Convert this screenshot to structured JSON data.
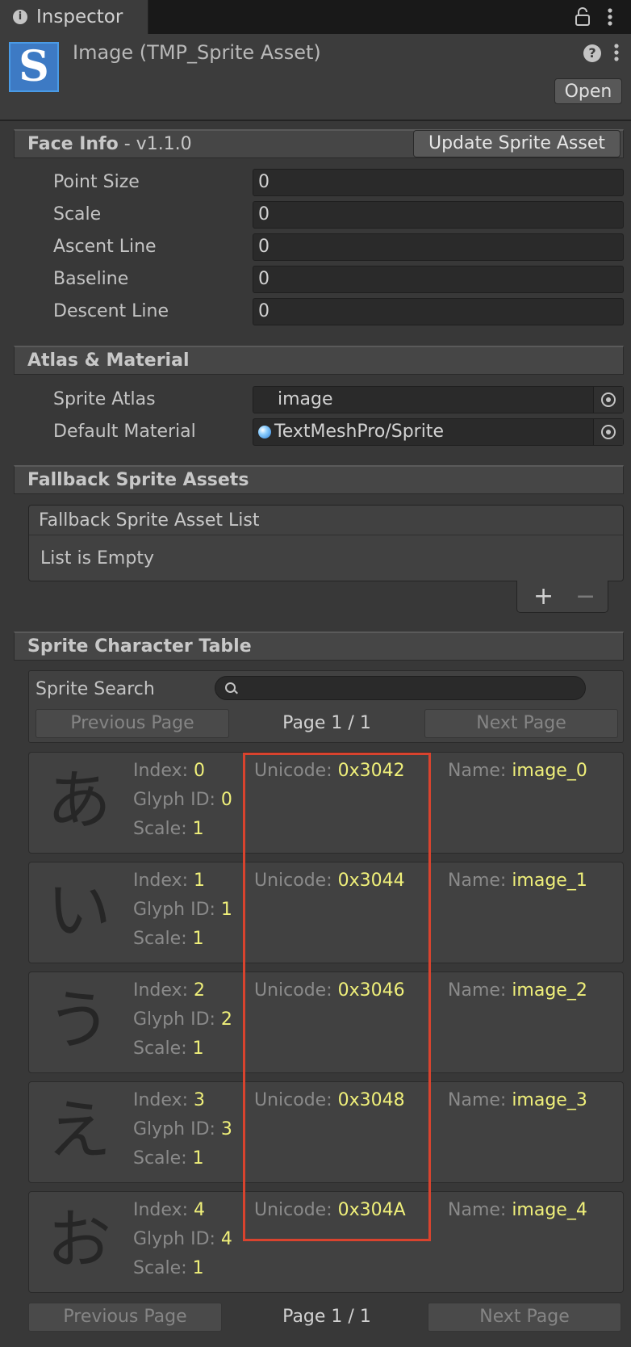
{
  "tab": {
    "title": "Inspector"
  },
  "header": {
    "icon_letter": "S",
    "title": "Image (TMP_Sprite Asset)",
    "open_label": "Open",
    "help_glyph": "?"
  },
  "face_info": {
    "title": "Face Info",
    "version": " - v1.1.0",
    "update_label": "Update Sprite Asset",
    "fields": [
      {
        "label": "Point Size",
        "value": "0"
      },
      {
        "label": "Scale",
        "value": "0"
      },
      {
        "label": "Ascent Line",
        "value": "0"
      },
      {
        "label": "Baseline",
        "value": "0"
      },
      {
        "label": "Descent Line",
        "value": "0"
      }
    ]
  },
  "atlas": {
    "title": "Atlas & Material",
    "sprite_atlas_label": "Sprite Atlas",
    "sprite_atlas_value": "image",
    "material_label": "Default Material",
    "material_value": "TextMeshPro/Sprite"
  },
  "fallback": {
    "title": "Fallback Sprite Assets",
    "list_title": "Fallback Sprite Asset List",
    "empty_text": "List is Empty",
    "add_glyph": "+",
    "remove_glyph": "−"
  },
  "table": {
    "title": "Sprite Character Table",
    "search_label": "Sprite Search",
    "search_value": "",
    "prev_label": "Previous Page",
    "next_label": "Next Page",
    "page_label": "Page 1 / 1",
    "keys": {
      "index": "Index: ",
      "glyph": "Glyph ID: ",
      "scale": "Scale: ",
      "unicode": "Unicode: ",
      "name": "Name: "
    },
    "rows": [
      {
        "glyph": "あ",
        "index": "0",
        "glyph_id": "0",
        "scale": "1",
        "unicode": "0x3042",
        "name": "image_0"
      },
      {
        "glyph": "い",
        "index": "1",
        "glyph_id": "1",
        "scale": "1",
        "unicode": "0x3044",
        "name": "image_1"
      },
      {
        "glyph": "う",
        "index": "2",
        "glyph_id": "2",
        "scale": "1",
        "unicode": "0x3046",
        "name": "image_2"
      },
      {
        "glyph": "え",
        "index": "3",
        "glyph_id": "3",
        "scale": "1",
        "unicode": "0x3048",
        "name": "image_3"
      },
      {
        "glyph": "お",
        "index": "4",
        "glyph_id": "4",
        "scale": "1",
        "unicode": "0x304A",
        "name": "image_4"
      }
    ]
  },
  "colors": {
    "value_yellow": "#f0f07a",
    "highlight_red": "#d9432e",
    "accent_blue": "#4a9be6"
  }
}
